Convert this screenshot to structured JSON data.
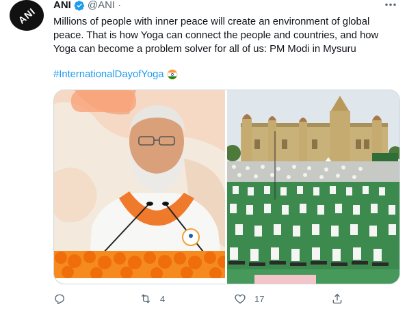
{
  "author": {
    "avatar_text": "ANI",
    "name": "ANI",
    "handle": "@ANI",
    "separator": "·",
    "verified": true
  },
  "tweet": {
    "text": "Millions of people with inner peace will create an environment of global peace. That is how Yoga can connect the people and countries, and how Yoga can become a problem solver for all of us: PM Modi in Mysuru",
    "hashtag": "#InternationalDayofYoga",
    "hashtag_emoji": "india-flag-circle-icon"
  },
  "media": [
    {
      "description_icon": "pm-modi-speaking-photo"
    },
    {
      "description_icon": "mysuru-palace-yoga-photo"
    }
  ],
  "actions": {
    "reply_count": "",
    "retweet_count": "4",
    "like_count": "17",
    "share_count": ""
  },
  "colors": {
    "accent": "#1d9bf0",
    "secondary_text": "#536471",
    "text": "#0f1419"
  }
}
